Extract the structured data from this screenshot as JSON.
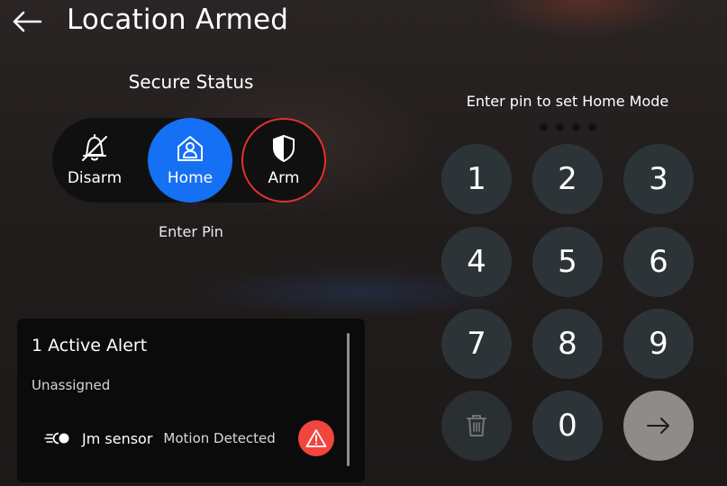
{
  "header": {
    "back_icon": "arrow-left-icon",
    "title": "Location Armed"
  },
  "secure_status": {
    "label": "Secure Status",
    "modes": [
      {
        "label": "Disarm",
        "icon": "bell-off-icon",
        "selected": false
      },
      {
        "label": "Home",
        "icon": "home-person-icon",
        "selected": true
      },
      {
        "label": "Arm",
        "icon": "shield-icon",
        "selected": false
      }
    ],
    "enter_pin_label": "Enter Pin"
  },
  "alerts": {
    "title": "1 Active Alert",
    "group": "Unassigned",
    "items": [
      {
        "icon": "motion-sensor-icon",
        "sensor": "Jm sensor",
        "status": "Motion Detected",
        "badge_icon": "warning-icon"
      }
    ]
  },
  "keypad": {
    "prompt": "Enter pin to set Home Mode",
    "pin_dots": 4,
    "keys": [
      "1",
      "2",
      "3",
      "4",
      "5",
      "6",
      "7",
      "8",
      "9",
      "0"
    ],
    "delete_icon": "trash-icon",
    "submit_icon": "arrow-right-icon"
  },
  "colors": {
    "accent_home": "#1570f3",
    "arm_ring": "#e0332e",
    "alert_red": "#f2453d",
    "key_bg": "#2d3438",
    "submit_bg": "#8f8b89"
  }
}
